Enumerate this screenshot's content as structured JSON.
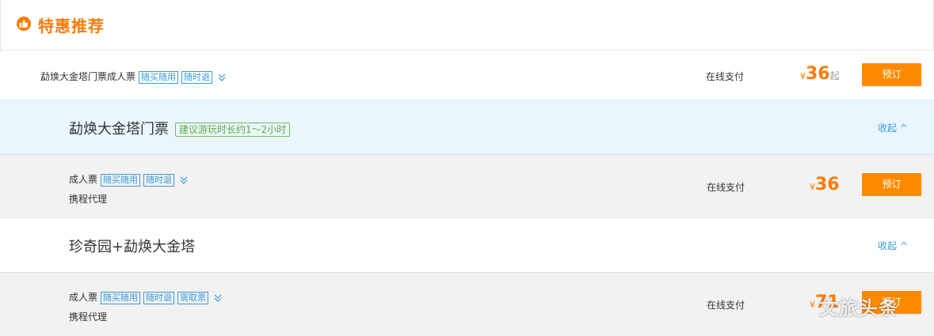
{
  "section": {
    "title": "特惠推荐"
  },
  "summary": {
    "name": "勐焕大金塔门票成人票",
    "tags": [
      "随买随用",
      "随时退"
    ],
    "payment": "在线支付",
    "price": {
      "currency": "¥",
      "value": "36",
      "suffix": "起"
    },
    "button": "预订"
  },
  "groups": [
    {
      "title": "勐焕大金塔门票",
      "tip": "建议游玩时长约1～2小时",
      "collapse": "收起 ^",
      "ticket": {
        "name": "成人票",
        "tags": [
          "随买随用",
          "随时退"
        ],
        "agent": "携程代理",
        "payment": "在线支付",
        "price": {
          "currency": "¥",
          "value": "36"
        },
        "button": "预订"
      }
    },
    {
      "title": "珍奇园+勐焕大金塔",
      "collapse": "收起 ^",
      "ticket": {
        "name": "成人票",
        "tags": [
          "随买随用",
          "随时退",
          "需取票"
        ],
        "agent": "携程代理",
        "payment": "在线支付",
        "price": {
          "currency": "¥",
          "value": "71"
        },
        "button": "预订"
      }
    }
  ],
  "watermark": "文旅头条",
  "colors": {
    "accent": "#ff7a00",
    "link": "#3b9ad9",
    "tip_green": "#62a843"
  }
}
